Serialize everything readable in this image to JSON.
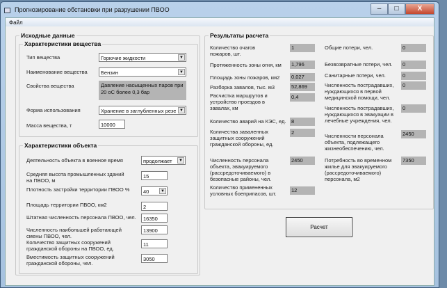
{
  "window": {
    "title": "Прогнозирование обстановки при разрушении ПВОО",
    "menu": [
      "Файл"
    ]
  },
  "input": {
    "title": "Исходные данные",
    "substance": {
      "title": "Характеристики вещества",
      "type_label": "Тип вещества",
      "type_value": "Горючие жидкости",
      "name_label": "Наименование вещества",
      "name_value": "Бензин",
      "props_label": "Свойства вещества",
      "props_value": "Давление насыщенных паров при 20 оС  более 0,3 бар",
      "form_label": "Форма использования",
      "form_value": "Хранение в заглубленных резер",
      "mass_label": "Масса вещества, т",
      "mass_value": "10000"
    },
    "object": {
      "title": "Характеристики объекта",
      "fields": [
        {
          "label": "Деятельность объекта в военное время",
          "value": "продолжает"
        },
        {
          "label": "Средняя высота промышленных зданий на ПВОО, м",
          "value": "15"
        },
        {
          "label": "Плотность застройки  территории ПВОО %",
          "value": "40"
        },
        {
          "label": "Площадь территории ПВОО, км2",
          "value": "2"
        },
        {
          "label": "Штатная численность персонала ПВОО, чел.",
          "value": "16350"
        },
        {
          "label": "Численность наибольшей работающей смены ПВОО, чел.",
          "value": "13900"
        },
        {
          "label": "Количество защитных сооружений гражданской обороны на ПВОО, ед.",
          "value": "11"
        },
        {
          "label": "Вместимость защитных сооружений гражданской обороны, чел.",
          "value": "3050"
        }
      ]
    }
  },
  "results": {
    "title": "Результаты расчета",
    "left": [
      {
        "label": "Количество очагов пожаров, шт.",
        "value": "1"
      },
      {
        "label": "Протяженность зоны огня, км",
        "value": "1,796"
      },
      {
        "label": "Площадь зоны пожаров, км2",
        "value": "0,027"
      },
      {
        "label": "Разборка завалов, тыс. м3",
        "value": "52,869"
      },
      {
        "label": "Расчистка маршрутов и устройство проездов в завалах, км",
        "value": "0,4"
      },
      {
        "label": "Количество аварий на КЭС, ед.",
        "value": "8"
      },
      {
        "label": "Количества заваленных защитных сооружений гражданской обороны, ед.",
        "value": "2"
      },
      {
        "label": "Численность персонала объекта, эвакуируемого (рассредоточиваемого) в безопасные районы, чел.",
        "value": "2450"
      },
      {
        "label": "Количество примененных условных боеприпасов, шт.",
        "value": "12"
      }
    ],
    "right": [
      {
        "label": "Общие потери, чел.",
        "value": "0"
      },
      {
        "label": "Безвозвратные потери, чел.",
        "value": "0"
      },
      {
        "label": "Санитарные потери, чел.",
        "value": "0"
      },
      {
        "label": "Численность пострадавших, нуждающихся в первой медицинской помощи, чел.",
        "value": "0"
      },
      {
        "label": "Численность пострадавших, нуждающихся в эвакуации в лечебные учреждения, чел.",
        "value": "0"
      },
      {
        "label": "Численности персонала объекта, подлежащего жизнеобеспечению, чел.",
        "value": "2450"
      },
      {
        "label": "Потребность во временном жилье для эвакуируемого (рассредоточиваемого) персонала, м2",
        "value": "7350"
      }
    ]
  },
  "calc_button": "Расчет"
}
